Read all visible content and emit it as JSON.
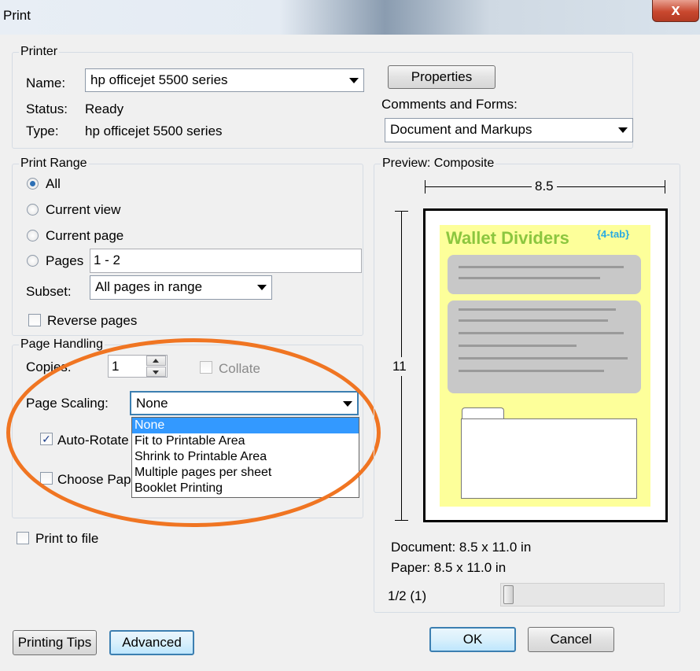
{
  "window": {
    "title": "Print",
    "close_label": "x"
  },
  "printer": {
    "legend": "Printer",
    "name_label": "Name:",
    "name_value": "hp officejet 5500 series",
    "status_label": "Status:",
    "status_value": "Ready",
    "type_label": "Type:",
    "type_value": "hp officejet 5500 series",
    "properties_button": "Properties",
    "comments_label": "Comments and Forms:",
    "comments_value": "Document and Markups"
  },
  "print_range": {
    "legend": "Print Range",
    "all": "All",
    "current_view": "Current view",
    "current_page": "Current page",
    "pages": "Pages",
    "pages_value": "1 - 2",
    "subset_label": "Subset:",
    "subset_value": "All pages in range",
    "reverse_pages": "Reverse pages"
  },
  "page_handling": {
    "legend": "Page Handling",
    "copies_label": "Copies:",
    "copies_value": "1",
    "collate": "Collate",
    "scaling_label": "Page Scaling:",
    "scaling_value": "None",
    "scaling_options": [
      "None",
      "Fit to Printable Area",
      "Shrink to Printable Area",
      "Multiple pages per sheet",
      "Booklet Printing"
    ],
    "auto_rotate": "Auto-Rotate",
    "choose_paper": "Choose Pap"
  },
  "print_to_file": "Print to file",
  "preview": {
    "legend": "Preview: Composite",
    "width_dim": "8.5",
    "height_dim": "11",
    "doc_heading": "Wallet Dividers",
    "doc_heading_tag": "{4-tab}",
    "document_info": "Document: 8.5 x 11.0 in",
    "paper_info": "Paper: 8.5 x 11.0 in",
    "page_indicator": "1/2 (1)"
  },
  "buttons": {
    "printing_tips": "Printing Tips",
    "advanced": "Advanced",
    "ok": "OK",
    "cancel": "Cancel"
  },
  "colors": {
    "highlight_ellipse": "#f07522",
    "selection": "#3399ff"
  }
}
